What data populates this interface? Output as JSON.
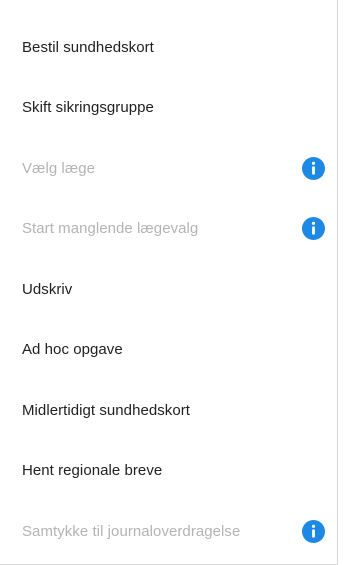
{
  "menu": {
    "items": [
      {
        "label": "Bestil sundhedskort",
        "disabled": false,
        "info_icon": false
      },
      {
        "label": "Skift sikringsgruppe",
        "disabled": false,
        "info_icon": false
      },
      {
        "label": "Vælg læge",
        "disabled": true,
        "info_icon": true
      },
      {
        "label": "Start manglende lægevalg",
        "disabled": true,
        "info_icon": true
      },
      {
        "label": "Udskriv",
        "disabled": false,
        "info_icon": false
      },
      {
        "label": "Ad hoc opgave",
        "disabled": false,
        "info_icon": false
      },
      {
        "label": "Midlertidigt sundhedskort",
        "disabled": false,
        "info_icon": false
      },
      {
        "label": "Hent regionale breve",
        "disabled": false,
        "info_icon": false
      },
      {
        "label": "Samtykke til journaloverdragelse",
        "disabled": true,
        "info_icon": true
      }
    ]
  },
  "colors": {
    "text": "#212121",
    "disabled_text": "#b4b4b4",
    "info_icon": "#1e88e5",
    "border": "#d6d6d6"
  },
  "icons": {
    "info": "info-icon"
  }
}
